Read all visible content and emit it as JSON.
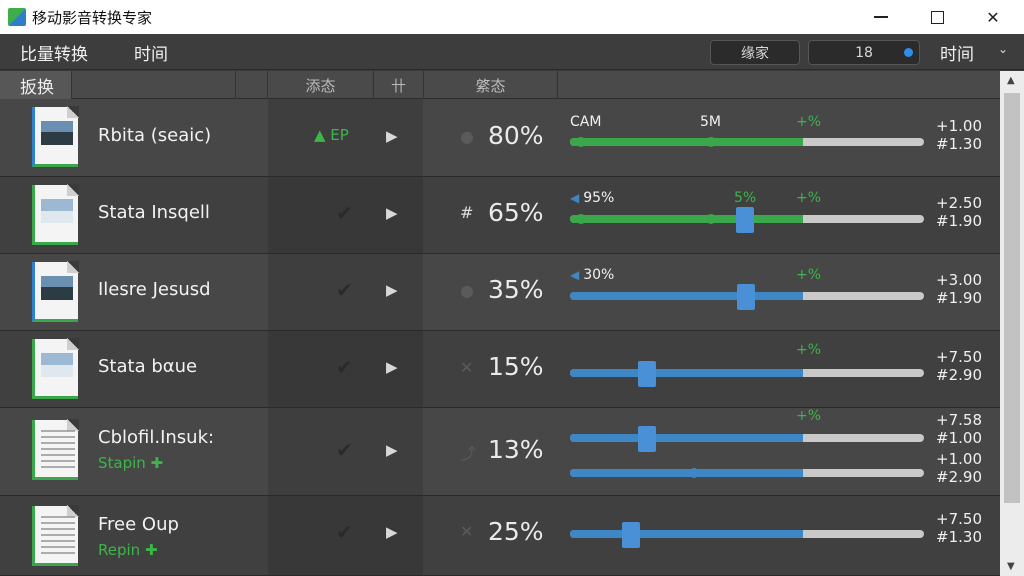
{
  "window": {
    "title": "移动影音转换专家"
  },
  "menubar": {
    "left_items": [
      "比量转换",
      "时间"
    ],
    "pill1": "缘家",
    "pill2": "18",
    "right_item": "时间"
  },
  "columns": {
    "c1": "扳换",
    "c2": "添态",
    "c3": "卄",
    "c4": "綮态"
  },
  "colors": {
    "accent_green": "#3aa84a",
    "accent_blue": "#3e86c4"
  },
  "rows": [
    {
      "name": "Rbita (ѕeaic)",
      "sub": "",
      "status": "▲ EP",
      "pct": "80%",
      "labels": [
        "CAM",
        "5M",
        "+%"
      ],
      "vals": [
        "+1.00",
        "#1.30"
      ],
      "progress": 0.66,
      "fill": "green"
    },
    {
      "name": "Stata Insqell",
      "sub": "",
      "status": "",
      "pct": "65%",
      "sicon": "#",
      "labels": [
        "95%",
        "5%",
        "+%"
      ],
      "vals": [
        "+2.50",
        "#1.90"
      ],
      "progress": 0.66,
      "fill": "green"
    },
    {
      "name": "Ilesre Jesusd",
      "sub": "",
      "status": "",
      "pct": "35%",
      "labels": [
        "30%",
        "+%"
      ],
      "vals": [
        "+3.00",
        "#1.90"
      ],
      "progress": 0.66,
      "fill": "blue"
    },
    {
      "name": "Stata bαue",
      "sub": "",
      "status": "",
      "pct": "15%",
      "sicon": "✕",
      "labels": [
        "+%"
      ],
      "vals": [
        "+7.50",
        "#2.90"
      ],
      "progress": 0.66,
      "fill": "blue"
    },
    {
      "name": "Cblofil.Insuk:",
      "sub": "Stapin ✚",
      "status": "",
      "pct": "13%",
      "sicon": "⤴",
      "labels": [
        "+%"
      ],
      "vals": [
        "+7.58",
        "#1.00"
      ],
      "vals2": [
        "+1.00",
        "#2.90"
      ],
      "progress": 0.66,
      "fill": "blue"
    },
    {
      "name": "Free Oup",
      "sub": "Repin ✚",
      "status": "",
      "pct": "25%",
      "sicon": "✕",
      "labels": [],
      "vals": [
        "+7.50",
        "#1.30"
      ],
      "progress": 0.66,
      "fill": "blue"
    }
  ]
}
